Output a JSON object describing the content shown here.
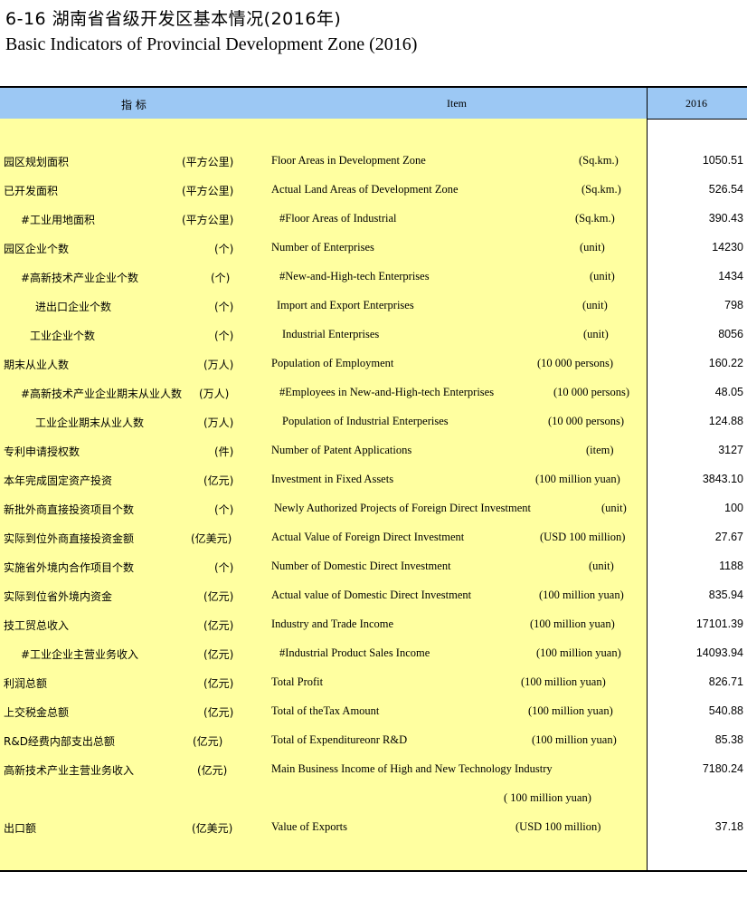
{
  "title_cn": "6-16   湖南省省级开发区基本情况(2016年)",
  "title_en": "Basic Indicators of  Provincial Development Zone (2016)",
  "header": {
    "indicator": "指 标",
    "item": "Item",
    "year": "2016"
  },
  "rows": [
    {
      "cn": "园区规划面积",
      "cn_unit": "(平方公里)",
      "en": "Floor Areas in Development Zone",
      "en_unit": "(Sq.km.)",
      "value": "1050.51"
    },
    {
      "cn": "已开发面积",
      "cn_unit": "(平方公里)",
      "en": "Actual Land Areas of Development Zone",
      "en_unit": "(Sq.km.)",
      "value": "526.54"
    },
    {
      "cn": "#工业用地面积",
      "cn_unit": "(平方公里)",
      "en": "#Floor Areas of Industrial",
      "en_unit": "(Sq.km.)",
      "value": "390.43"
    },
    {
      "cn": "园区企业个数",
      "cn_unit": "(个)",
      "en": "Number of Enterprises",
      "en_unit": "(unit)",
      "value": "14230"
    },
    {
      "cn": "#高新技术产业企业个数",
      "cn_unit": "(个)",
      "en": "#New-and-High-tech Enterprises",
      "en_unit": "(unit)",
      "value": "1434"
    },
    {
      "cn": "进出口企业个数",
      "cn_unit": "(个)",
      "en": "Import and Export Enterprises",
      "en_unit": "(unit)",
      "value": "798"
    },
    {
      "cn": "工业企业个数",
      "cn_unit": "(个)",
      "en": "Industrial Enterprises",
      "en_unit": "(unit)",
      "value": "8056"
    },
    {
      "cn": "期末从业人数",
      "cn_unit": "(万人)",
      "en": "Population of Employment",
      "en_unit": "(10 000 persons)",
      "value": "160.22"
    },
    {
      "cn": "#高新技术产业企业期末从业人数",
      "cn_unit": "(万人)",
      "en": "#Employees in New-and-High-tech Enterprises",
      "en_unit": "(10 000 persons)",
      "value": "48.05"
    },
    {
      "cn": "工业企业期末从业人数",
      "cn_unit": "(万人)",
      "en": "Population of Industrial Enterperises",
      "en_unit": "(10 000 persons)",
      "value": "124.88"
    },
    {
      "cn": "专利申请授权数",
      "cn_unit": "(件)",
      "en": "Number of Patent Applications",
      "en_unit": "(item)",
      "value": "3127"
    },
    {
      "cn": "本年完成固定资产投资",
      "cn_unit": "(亿元)",
      "en": "Investment in Fixed Assets",
      "en_unit": "(100 million yuan)",
      "value": "3843.10"
    },
    {
      "cn": "新批外商直接投资项目个数",
      "cn_unit": "(个)",
      "en": "Newly Authorized Projects of Foreign Direct Investment",
      "en_unit": "(unit)",
      "value": "100"
    },
    {
      "cn": "实际到位外商直接投资金额",
      "cn_unit": "(亿美元)",
      "en": "Actual Value of Foreign Direct Investment",
      "en_unit": "(USD 100 million)",
      "value": "27.67"
    },
    {
      "cn": "实施省外境内合作项目个数",
      "cn_unit": "(个)",
      "en": "Number of Domestic Direct Investment",
      "en_unit": "(unit)",
      "value": "1188"
    },
    {
      "cn": "实际到位省外境内资金",
      "cn_unit": "(亿元)",
      "en": "Actual value of  Domestic Direct Investment",
      "en_unit": "(100 million yuan)",
      "value": "835.94"
    },
    {
      "cn": "技工贸总收入",
      "cn_unit": "(亿元)",
      "en": "Industry and Trade Income",
      "en_unit": "(100 million  yuan)",
      "value": "17101.39"
    },
    {
      "cn": "#工业企业主营业务收入",
      "cn_unit": "(亿元)",
      "en": "#Industrial Product Sales Income",
      "en_unit": "(100 million yuan)",
      "value": "14093.94"
    },
    {
      "cn": "利润总额",
      "cn_unit": "(亿元)",
      "en": "Total Profit",
      "en_unit": "(100 million yuan)",
      "value": "826.71"
    },
    {
      "cn": "上交税金总额",
      "cn_unit": "(亿元)",
      "en": "Total of theTax Amount",
      "en_unit": "(100 million yuan)",
      "value": "540.88"
    },
    {
      "cn": "R&D经费内部支出总额",
      "cn_unit": "(亿元)",
      "en": "Total of Expenditureonr R&D",
      "en_unit": "(100 million yuan)",
      "value": "85.38"
    },
    {
      "cn": "高新技术产业主营业务收入",
      "cn_unit": "(亿元)",
      "en": "Main Business Income of High and New Technology Industry",
      "en_unit": "",
      "value": "7180.24"
    },
    {
      "cn": "",
      "cn_unit": "",
      "en": "",
      "en_unit": "( 100 million yuan)",
      "value": ""
    },
    {
      "cn": "出口额",
      "cn_unit": "(亿美元)",
      "en": "Value of Exports",
      "en_unit": "(USD 100 million)",
      "value": "37.18"
    }
  ]
}
